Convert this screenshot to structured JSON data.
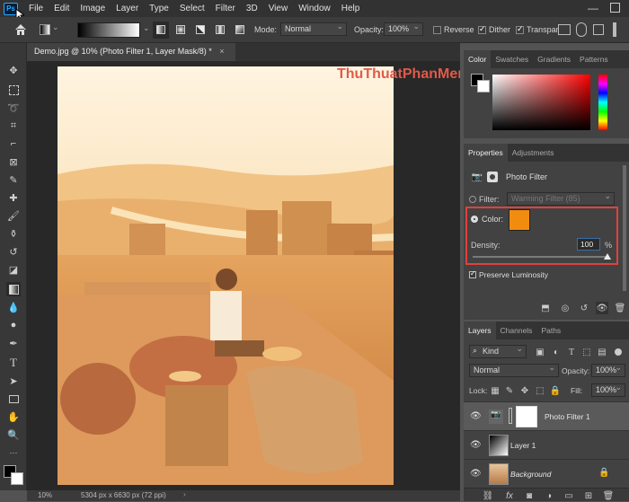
{
  "app": {
    "logo_text": "Ps"
  },
  "menu": [
    "File",
    "Edit",
    "Image",
    "Layer",
    "Type",
    "Select",
    "Filter",
    "3D",
    "View",
    "Window",
    "Help"
  ],
  "options_bar": {
    "mode_label": "Mode:",
    "mode_value": "Normal",
    "opacity_label": "Opacity:",
    "opacity_value": "100%",
    "reverse_label": "Reverse",
    "dither_label": "Dither",
    "transparency_label": "Transpar"
  },
  "document": {
    "tab_title": "Demo.jpg @ 10% (Photo Filter 1, Layer Mask/8) *",
    "close_glyph": "×",
    "watermark": "ThuThuatPhanMem.vn"
  },
  "status": {
    "zoom": "10%",
    "doc_info": "5304 px x 6630 px (72 ppi)",
    "arrow": "›"
  },
  "color_panel": {
    "tabs": [
      "Color",
      "Swatches",
      "Gradients",
      "Patterns"
    ],
    "active": "Color"
  },
  "properties_panel": {
    "tabs": [
      "Properties",
      "Adjustments"
    ],
    "title": "Photo Filter",
    "filter_label": "Filter:",
    "filter_value": "Warming Filter (85)",
    "color_label": "Color:",
    "filter_color": "#f28c0f",
    "density_label": "Density:",
    "density_value": "100",
    "density_unit": "%",
    "density_level": 1.0,
    "preserve_label": "Preserve Luminosity",
    "highlight_color": "#e0413d"
  },
  "layers_panel": {
    "tabs": [
      "Layers",
      "Channels",
      "Paths"
    ],
    "kind_label": "Kind",
    "blend_mode": "Normal",
    "opacity_label": "Opacity:",
    "opacity_value": "100%",
    "lock_label": "Lock:",
    "fill_label": "Fill:",
    "fill_value": "100%",
    "layers": [
      {
        "name": "Photo Filter 1",
        "selected": true
      },
      {
        "name": "Layer 1",
        "selected": false
      },
      {
        "name": "Background",
        "selected": false
      }
    ]
  }
}
